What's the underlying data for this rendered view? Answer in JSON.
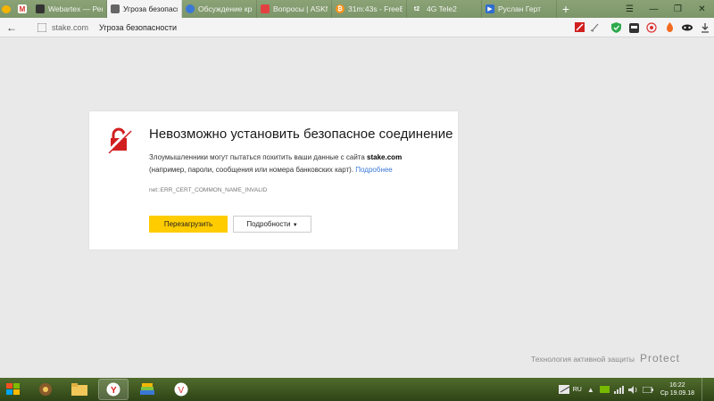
{
  "tabs": [
    {
      "label": "",
      "icon": "yandex-browser-icon",
      "color": "#f4b400",
      "pinned": true
    },
    {
      "label": "",
      "icon": "gmail-icon",
      "color": "#d93025",
      "pinned": true
    },
    {
      "label": "Webartex — Рекла",
      "icon": "webartex-icon",
      "color": "#333333"
    },
    {
      "label": "Угроза безопасно",
      "icon": "shield-warning-icon",
      "color": "#555555",
      "active": true
    },
    {
      "label": "Обсуждение крип",
      "icon": "globe-icon",
      "color": "#3b78d6"
    },
    {
      "label": "Вопросы | ASKfm",
      "icon": "askfm-icon",
      "color": "#e34141"
    },
    {
      "label": "31m:43s - FreeBitc",
      "icon": "bitcoin-icon",
      "color": "#f7931a"
    },
    {
      "label": "4G Tele2",
      "icon": "tele2-icon",
      "color": "#111111",
      "badge": "t2"
    },
    {
      "label": "Руслан Герт",
      "icon": "video-icon",
      "color": "#2e6cd1"
    }
  ],
  "address": {
    "domain": "stake.com",
    "title": "Угроза безопасности"
  },
  "error": {
    "heading": "Невозможно установить безопасное соединение",
    "line1_pre": "Злоумышленники могут пытаться похитить ваши данные с сайта ",
    "line1_domain": "stake.com",
    "line2_pre": "(например, пароли, сообщения или номера банковских карт). ",
    "more_link": "Подробнее",
    "code": "net::ERR_CERT_COMMON_NAME_INVALID",
    "reload_label": "Перезагрузить",
    "details_label": "Подробности",
    "details_arrow": "▼",
    "accent": "#ffcc00",
    "lock_color": "#d11f1f"
  },
  "protect": {
    "caption": "Технология активной защиты",
    "logo": "Protect"
  },
  "taskbar": {
    "lang": "RU",
    "time": "16:22",
    "date": "Ср 19.09.18"
  }
}
